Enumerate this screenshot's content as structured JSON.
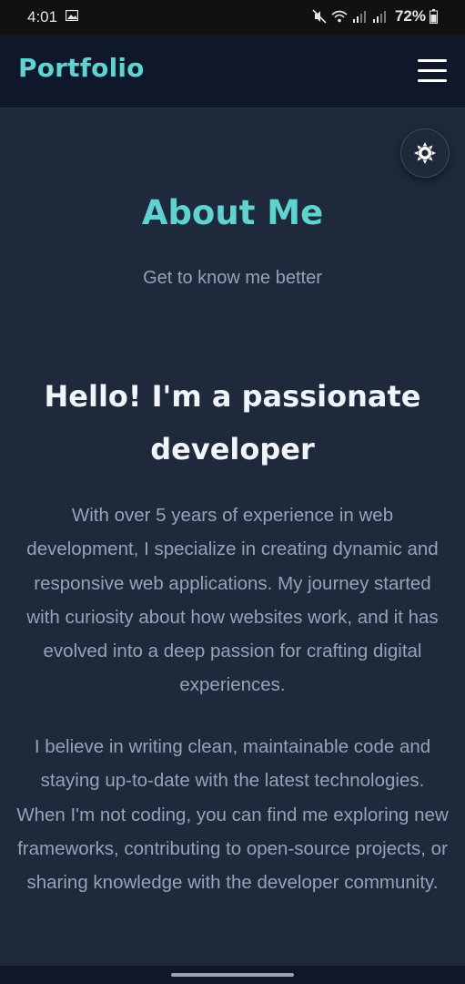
{
  "status_bar": {
    "time": "4:01",
    "battery_percent": "72%",
    "icons": [
      "gallery-icon",
      "mute-icon",
      "wifi-icon",
      "signal-icon",
      "signal-icon",
      "battery-icon"
    ]
  },
  "navbar": {
    "brand": "Portfolio",
    "menu_icon": "hamburger-menu-icon"
  },
  "theme_toggle": {
    "icon": "sun-icon"
  },
  "about": {
    "title": "About Me",
    "subtitle": "Get to know me better",
    "heading": "Hello! I'm a passionate developer",
    "paragraphs": [
      "With over 5 years of experience in web development, I specialize in creating dynamic and responsive web applications. My journey started with curiosity about how websites work, and it has evolved into a deep passion for crafting digital experiences.",
      "I believe in writing clean, maintainable code and staying up-to-date with the latest technologies. When I'm not coding, you can find me exploring new frameworks, contributing to open-source projects, or sharing knowledge with the developer community."
    ]
  },
  "colors": {
    "background": "#1e293b",
    "navbar": "#0f172a",
    "accent": "#5fd3d0",
    "heading": "#f1f5f9",
    "body_text": "#94a3b8"
  }
}
